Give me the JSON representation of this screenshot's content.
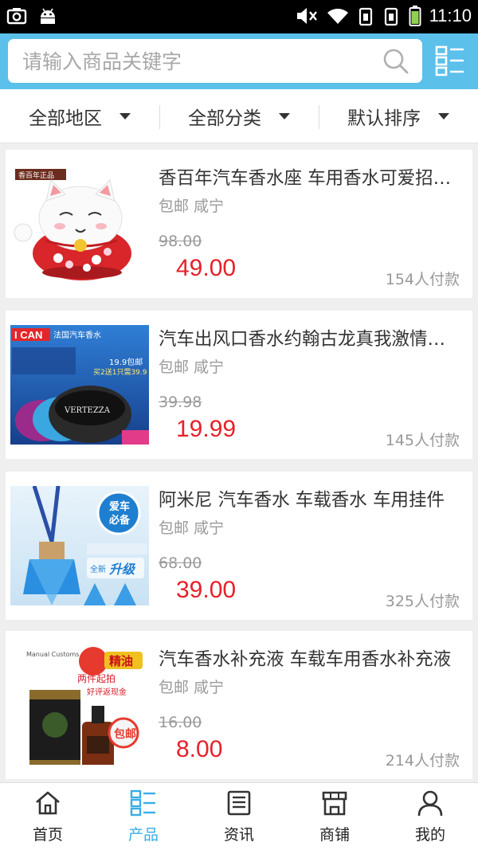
{
  "status_bar": {
    "time": "11:10"
  },
  "search": {
    "placeholder": "请输入商品关键字"
  },
  "filters": [
    {
      "label": "全部地区"
    },
    {
      "label": "全部分类"
    },
    {
      "label": "默认排序"
    }
  ],
  "products": [
    {
      "title": "香百年汽车香水座 车用香水可爱招财猫",
      "meta": "包邮 咸宁",
      "old_price": "98.00",
      "price": "49.00",
      "sold": "154人付款",
      "image_badge": "香百年正品"
    },
    {
      "title": "汽车出风口香水约翰古龙真我激情香水",
      "meta": "包邮 咸宁",
      "old_price": "39.98",
      "price": "19.99",
      "sold": "145人付款",
      "image_text_1": "I CAN",
      "image_text_2": "法国汽车香水",
      "image_text_3": "19.9包邮",
      "image_text_4": "买2送1只需39.9",
      "image_text_5": "VERTEZZA"
    },
    {
      "title": "阿米尼 汽车香水 车载香水 车用挂件",
      "meta": "包邮 咸宁",
      "old_price": "68.00",
      "price": "39.00",
      "sold": "325人付款",
      "image_text_1": "爱车",
      "image_text_2": "必备",
      "image_text_3": "全新",
      "image_text_4": "升级"
    },
    {
      "title": "汽车香水补充液 车载车用香水补充液",
      "meta": "包邮 咸宁",
      "old_price": "16.00",
      "price": "8.00",
      "sold": "214人付款",
      "image_text_1": "Manual Customs",
      "image_text_2": "精油",
      "image_text_3": "两件起拍",
      "image_text_4": "好评返现金",
      "image_text_5": "包邮"
    }
  ],
  "tabs": [
    {
      "label": "首页",
      "icon": "home-icon"
    },
    {
      "label": "产品",
      "icon": "grid-list-icon",
      "active": true
    },
    {
      "label": "资讯",
      "icon": "news-icon"
    },
    {
      "label": "商铺",
      "icon": "store-icon"
    },
    {
      "label": "我的",
      "icon": "user-icon"
    }
  ],
  "colors": {
    "header": "#5bc0ea",
    "price": "#e8202a",
    "active_tab": "#38aee6"
  }
}
